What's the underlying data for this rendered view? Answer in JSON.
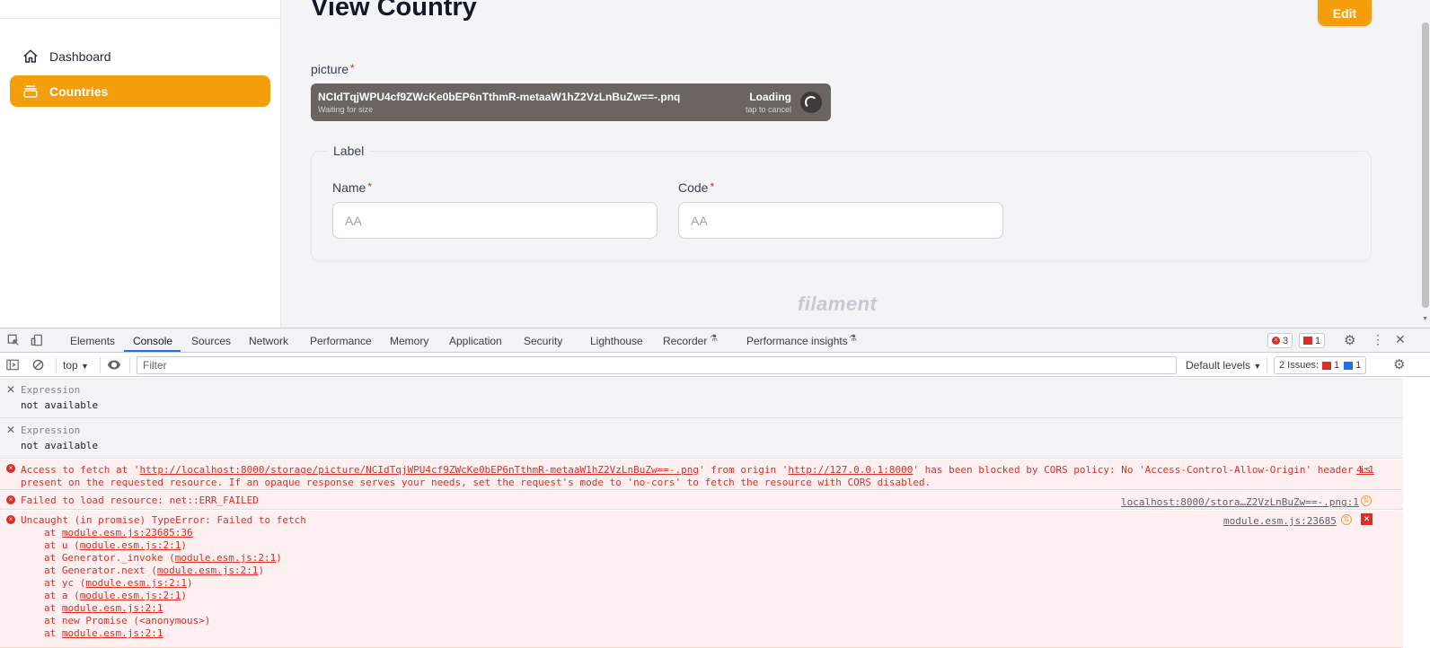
{
  "sidebar": {
    "items": [
      {
        "label": "Dashboard",
        "icon": "home-icon",
        "active": false
      },
      {
        "label": "Countries",
        "icon": "collection-icon",
        "active": true
      }
    ]
  },
  "header": {
    "title": "View Country",
    "edit_label": "Edit"
  },
  "form": {
    "picture": {
      "label": "picture",
      "required": "*",
      "file_name": "NCIdTqjWPU4cf9ZWcKe0bEP6nTthmR-metaaW1hZ2VzLnBuZw==-.pnq",
      "file_status": "Waiting for size",
      "loading": "Loading",
      "cancel_hint": "tap to cancel"
    },
    "section": {
      "legend": "Label",
      "name": {
        "label": "Name",
        "required": "*",
        "value": "AA"
      },
      "code": {
        "label": "Code",
        "required": "*",
        "value": "AA"
      }
    }
  },
  "footer": {
    "brand": "filament"
  },
  "devtools": {
    "tabs": [
      "Elements",
      "Console",
      "Sources",
      "Network",
      "Performance",
      "Memory",
      "Application",
      "Security",
      "Lighthouse",
      "Recorder",
      "Performance insights"
    ],
    "active_tab": "Console",
    "error_count": "3",
    "issue_flag_count": "1",
    "context": "top",
    "filter_placeholder": "Filter",
    "levels": "Default levels",
    "issues_label": "2 Issues:",
    "issues_errors": "1",
    "issues_info": "1",
    "console": {
      "expressions": [
        {
          "label": "Expression",
          "value": "not available"
        },
        {
          "label": "Expression",
          "value": "not available"
        }
      ],
      "cors_error": {
        "prefix": "Access to fetch at '",
        "url": "http://localhost:8000/storage/picture/NCIdTqjWPU4cf9ZWcKe0bEP6nTthmR-metaaW1hZ2VzLnBuZw==-.png",
        "mid": "' from origin '",
        "origin": "http://127.0.0.1:8000",
        "suffix": "' has been blocked by CORS policy: No 'Access-Control-Allow-Origin' header is",
        "line2": "present on the requested resource. If an opaque response serves your needs, set the request's mode to 'no-cors' to fetch the resource with CORS disabled.",
        "source": "4:1"
      },
      "load_error": {
        "text": "Failed to load resource: net::ERR_FAILED",
        "source": "localhost:8000/stora…Z2VzLnBuZw==-.png:1"
      },
      "uncaught": {
        "text": "Uncaught (in promise) TypeError: Failed to fetch",
        "source": "module.esm.js:23685",
        "stack": [
          {
            "prefix": "at ",
            "link": "module.esm.js:23685:36",
            "suffix": ""
          },
          {
            "prefix": "at u (",
            "link": "module.esm.js:2:1",
            "suffix": ")"
          },
          {
            "prefix": "at Generator._invoke (",
            "link": "module.esm.js:2:1",
            "suffix": ")"
          },
          {
            "prefix": "at Generator.next (",
            "link": "module.esm.js:2:1",
            "suffix": ")"
          },
          {
            "prefix": "at yc (",
            "link": "module.esm.js:2:1",
            "suffix": ")"
          },
          {
            "prefix": "at a (",
            "link": "module.esm.js:2:1",
            "suffix": ")"
          },
          {
            "prefix": "at ",
            "link": "module.esm.js:2:1",
            "suffix": ""
          },
          {
            "prefix": "at new Promise (<anonymous>)",
            "link": "",
            "suffix": ""
          },
          {
            "prefix": "at ",
            "link": "module.esm.js:2:1",
            "suffix": ""
          }
        ]
      }
    }
  },
  "colors": {
    "accent": "#f59e0b",
    "error": "#d93025",
    "devtools_blue": "#1a73e8"
  }
}
